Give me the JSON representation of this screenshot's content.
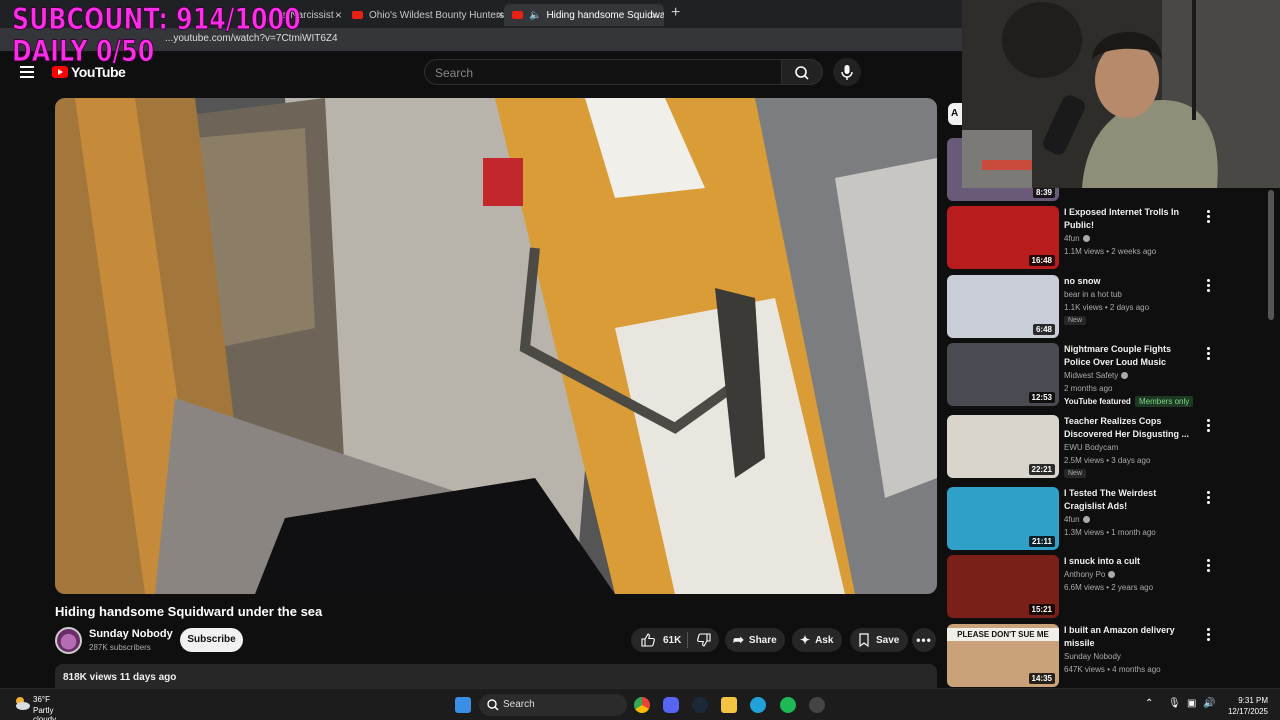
{
  "overlay": {
    "line1": "SUBCOUNT: 914/1000",
    "line2": "DAILY 0/50"
  },
  "browser": {
    "tabs": [
      {
        "label": "a Narcissist - Y"
      },
      {
        "label": "Ohio's Wildest Bounty Hunters - Y"
      },
      {
        "label": "Hiding handsome Squidward"
      }
    ],
    "url": "...youtube.com/watch?v=7CtmiWIT6Z4"
  },
  "header": {
    "logo": "YouTube",
    "search_placeholder": "Search"
  },
  "video": {
    "title": "Hiding handsome Squidward under the sea",
    "channel": "Sunday Nobody",
    "subscribers": "287K subscribers",
    "subscribe_label": "Subscribe",
    "likes": "61K",
    "share_label": "Share",
    "ask_label": "Ask",
    "save_label": "Save",
    "views_date": "818K views  11 days ago"
  },
  "sidebar": {
    "chip": "A",
    "items": [
      {
        "title": "",
        "channel": "",
        "meta": "",
        "duration": "8:39",
        "thumb": "#6a5a7a"
      },
      {
        "title": "I Exposed Internet Trolls In Public!",
        "channel": "4fun",
        "meta": "1.1M views • 2 weeks ago",
        "duration": "16:48",
        "thumb": "#b81c1c"
      },
      {
        "title": "no snow",
        "channel": "bear in a hot tub",
        "meta": "1.1K views • 2 days ago",
        "duration": "6:48",
        "badge": "New",
        "thumb": "#c9cdd8"
      },
      {
        "title": "Nightmare Couple Fights Police Over Loud Music",
        "channel": "Midwest Safety",
        "meta": "2 months ago",
        "duration": "12:53",
        "extra": "YouTube featured",
        "members": "Members only",
        "thumb": "#4a4a52"
      },
      {
        "title": "Teacher Realizes Cops Discovered Her Disgusting ...",
        "channel": "EWU Bodycam",
        "meta": "2.5M views • 3 days ago",
        "duration": "22:21",
        "badge": "New",
        "thumb": "#d9d4cc"
      },
      {
        "title": "I Tested The Weirdest Cragislist Ads!",
        "channel": "4fun",
        "meta": "1.3M views • 1 month ago",
        "duration": "21:11",
        "thumb": "#2fa0c8"
      },
      {
        "title": "I snuck into a cult",
        "channel": "Anthony Po",
        "meta": "6.6M views • 2 years ago",
        "duration": "15:21",
        "thumb": "#7a2018"
      },
      {
        "title": "I built an Amazon delivery missile",
        "channel": "Sunday Nobody",
        "meta": "647K views • 4 months ago",
        "duration": "14:35",
        "thumb_text": "PLEASE DON'T SUE ME",
        "thumb": "#c9a27a"
      }
    ]
  },
  "taskbar": {
    "temperature": "36°F",
    "condition": "Partly cloudy",
    "search_label": "Search",
    "time": "9:31 PM",
    "date": "12/17/2025"
  }
}
